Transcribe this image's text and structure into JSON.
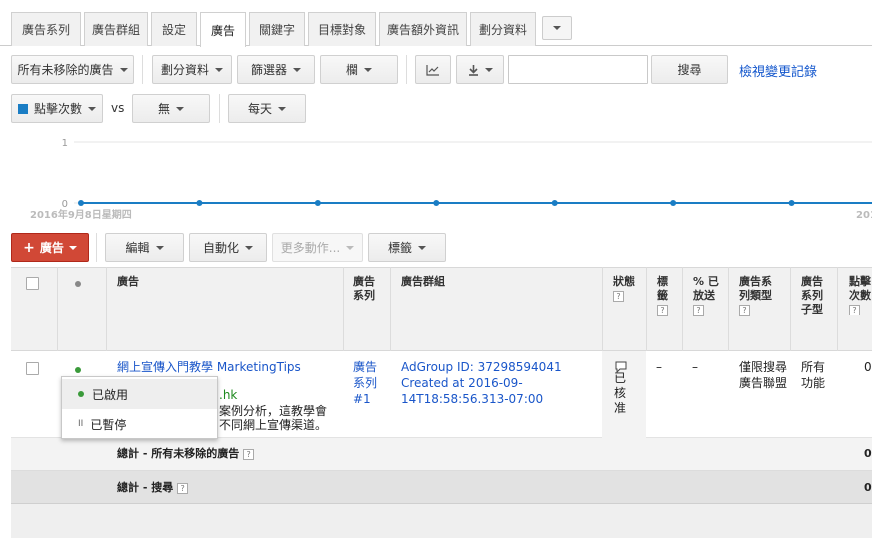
{
  "tabs": [
    "廣告系列",
    "廣告群組",
    "設定",
    "廣告",
    "關鍵字",
    "目標對象",
    "廣告額外資訊",
    "劃分資料"
  ],
  "toolbar": {
    "filter_ads": "所有未移除的廣告",
    "segment": "劃分資料",
    "filter": "篩選器",
    "columns": "欄",
    "search_label": "搜尋",
    "search_value": "",
    "change_history": "檢視變更記錄"
  },
  "graph_controls": {
    "metric": "點擊次數",
    "vs": "vs",
    "compare": "無",
    "period": "每天"
  },
  "chart_data": {
    "type": "line",
    "y_ticks": [
      "0",
      "1"
    ],
    "x_start_label": "2016年9月8日星期四",
    "x_end_label": "201",
    "ylim": [
      0,
      1
    ],
    "series": [
      {
        "values": [
          0,
          0,
          0,
          0,
          0,
          0,
          0,
          0
        ]
      }
    ],
    "series_color": "#1a7dc4",
    "grid": true
  },
  "actions": {
    "ad_button": "廣告",
    "edit": "編輯",
    "automate": "自動化",
    "more_actions": "更多動作...",
    "labels": "標籤"
  },
  "table": {
    "headers": {
      "ad": "廣告",
      "campaign": "廣告系列",
      "ad_group": "廣告群組",
      "status": "狀態",
      "labels": "標籤",
      "pct_served": "% 已放送",
      "campaign_type": "廣告系列類型",
      "campaign_subtype": "廣告系列子型",
      "clicks": "點擊次數"
    },
    "row": {
      "ad_title": "網上宣傳入門教學 MarketingTips",
      "ad_url_tail": ".hk",
      "ad_desc1": "案例分析，這教學會",
      "ad_desc2": "不同網上宣傳渠道。",
      "campaign": "廣告系列 #1",
      "ad_group": "AdGroup ID: 37298594041 Created at 2016-09-14T18:58:56.313-07:00",
      "status": "已核准",
      "labels": "–",
      "pct_served": "–",
      "campaign_type": "僅限搜尋廣告聯盟",
      "campaign_subtype": "所有功能",
      "clicks": "0"
    },
    "total_all": {
      "label": "總計 - 所有未移除的廣告",
      "clicks": "0"
    },
    "total_search": {
      "label": "總計 - 搜尋",
      "clicks": "0"
    }
  },
  "status_menu": {
    "enabled": "已啟用",
    "paused": "已暫停"
  },
  "colors": {
    "accent_red": "#d14836",
    "link_blue": "#1155cc",
    "enabled_green": "#3a9a3a",
    "series_blue": "#1a7dc4"
  }
}
